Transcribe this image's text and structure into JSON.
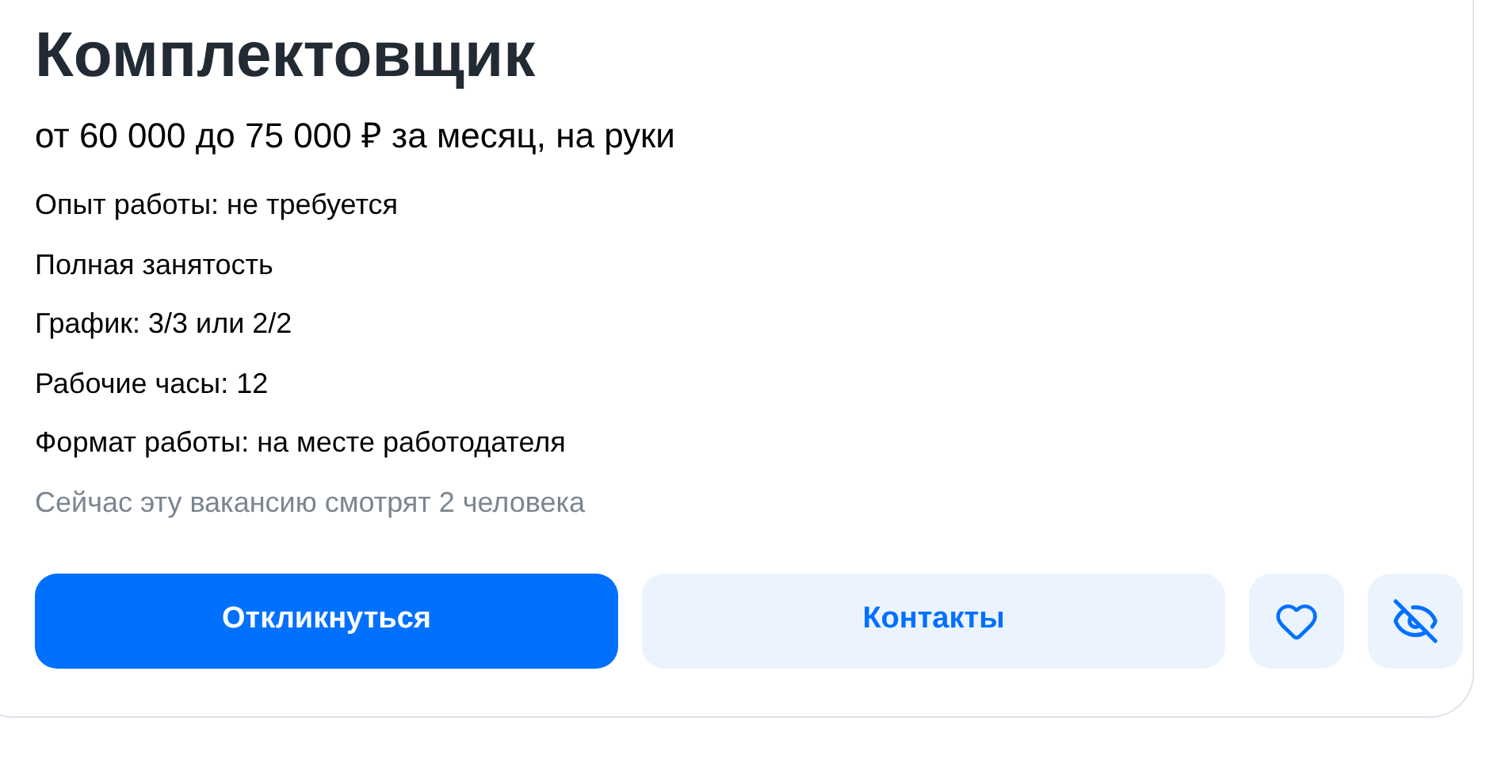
{
  "title": "Комплектовщик",
  "salary": "от 60 000 до 75 000 ₽ за месяц, на руки",
  "details": [
    "Опыт работы: не требуется",
    "Полная занятость",
    "График: 3/3 или 2/2",
    "Рабочие часы: 12",
    "Формат работы: на месте работодателя"
  ],
  "viewers": "Сейчас эту вакансию смотрят 2 человека",
  "buttons": [
    {
      "kind": "primary",
      "label": "Откликнуться"
    },
    {
      "kind": "secondary",
      "label": "Контакты"
    },
    {
      "kind": "favorite"
    },
    {
      "kind": "hide"
    }
  ]
}
